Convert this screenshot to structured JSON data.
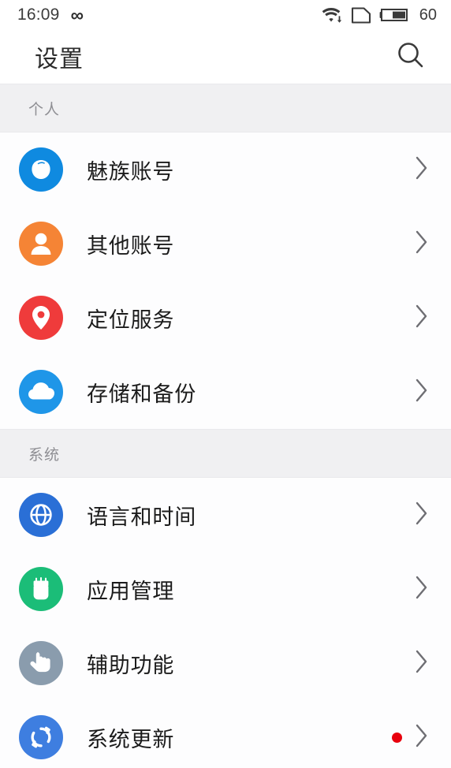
{
  "status_bar": {
    "clock": "16:09",
    "infinity_glyph": "∞",
    "icons": [
      "wifi-download-icon",
      "sim-card-icon",
      "battery-icon"
    ],
    "battery_percent": "60"
  },
  "title_bar": {
    "title": "设置",
    "search_icon": "search-icon"
  },
  "sections": [
    {
      "header": "个人",
      "items": [
        {
          "label": "魅族账号",
          "icon": "meizu-account-icon",
          "icon_color": "#0f8ae0",
          "badge": false,
          "chevron": true
        },
        {
          "label": "其他账号",
          "icon": "person-icon",
          "icon_color": "#f58435",
          "badge": false,
          "chevron": true
        },
        {
          "label": "定位服务",
          "icon": "location-pin-icon",
          "icon_color": "#ef3b3b",
          "badge": false,
          "chevron": true
        },
        {
          "label": "存储和备份",
          "icon": "cloud-icon",
          "icon_color": "#1f96e8",
          "badge": false,
          "chevron": true
        }
      ]
    },
    {
      "header": "系统",
      "items": [
        {
          "label": "语言和时间",
          "icon": "globe-icon",
          "icon_color": "#2a6fd6",
          "badge": false,
          "chevron": true
        },
        {
          "label": "应用管理",
          "icon": "android-robot-icon",
          "icon_color": "#1bbd78",
          "badge": false,
          "chevron": true
        },
        {
          "label": "辅助功能",
          "icon": "hand-pointer-icon",
          "icon_color": "#8a9cad",
          "badge": false,
          "chevron": true
        },
        {
          "label": "系统更新",
          "icon": "sync-refresh-icon",
          "icon_color": "#3e7ee0",
          "badge": true,
          "chevron": true
        }
      ]
    }
  ],
  "colors": {
    "page_background": "#fdfdfe",
    "section_header_background": "#f0f0f2",
    "section_header_text": "#8e8e93",
    "row_text": "#1b1b1b",
    "chevron": "#6e6e73",
    "badge_red": "#e8000d"
  }
}
